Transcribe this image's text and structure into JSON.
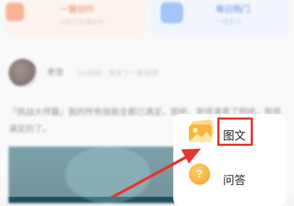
{
  "background": {
    "card_left": {
      "title": "一键创作",
      "subtitle": "AI助力快速创作"
    },
    "card_right": {
      "title": "每日热门",
      "subtitle": "一键参与"
    },
    "post": {
      "author": "老张",
      "meta": "3小时前 · 发布了一条动态",
      "text": "「挑战大师篇」我的所有技能全都已满足，图纸，我很满意了图纸，我很满足的了。"
    }
  },
  "popup": {
    "items": [
      {
        "label": "图文",
        "icon": "image-icon"
      },
      {
        "label": "问答",
        "icon": "question-icon",
        "glyph": "?"
      }
    ]
  },
  "annotation": {
    "highlight_color": "#e8332f",
    "arrow_color": "#e8332f"
  }
}
